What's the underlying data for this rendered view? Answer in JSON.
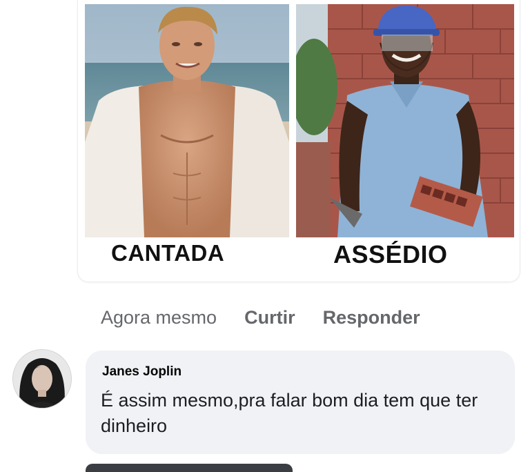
{
  "meme": {
    "left_caption": "CANTADA",
    "right_caption": "ASSÉDIO"
  },
  "actions": {
    "timestamp": "Agora mesmo",
    "like_label": "Curtir",
    "reply_label": "Responder"
  },
  "comment": {
    "author": "Janes Joplin",
    "text": "É assim mesmo,pra falar bom dia tem que ter dinheiro"
  },
  "colors": {
    "bubble_bg": "#f0f2f5",
    "secondary_text": "#65676b",
    "primary_text": "#050505"
  }
}
